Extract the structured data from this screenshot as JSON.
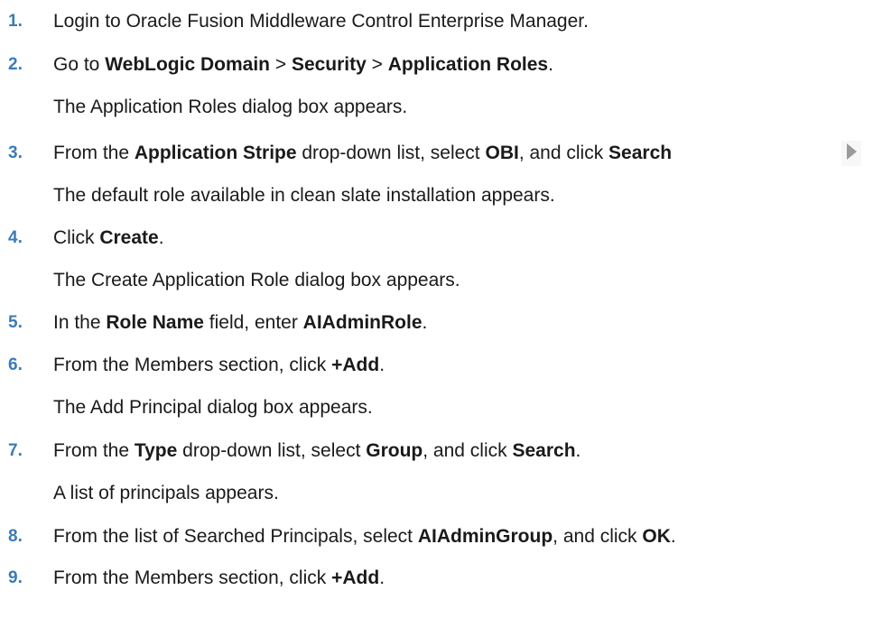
{
  "steps": [
    {
      "number": "1.",
      "parts": [
        {
          "t": "Login to Oracle Fusion Middleware Control Enterprise Manager.",
          "b": false
        }
      ],
      "result": ""
    },
    {
      "number": "2.",
      "parts": [
        {
          "t": "Go to ",
          "b": false
        },
        {
          "t": "WebLogic Domain",
          "b": true
        },
        {
          "t": " > ",
          "b": false
        },
        {
          "t": "Security",
          "b": true
        },
        {
          "t": " > ",
          "b": false
        },
        {
          "t": "Application Roles",
          "b": true
        },
        {
          "t": ".",
          "b": false
        }
      ],
      "result": "The Application Roles dialog box appears."
    },
    {
      "number": "3.",
      "parts": [
        {
          "t": "From the ",
          "b": false
        },
        {
          "t": "Application Stripe",
          "b": true
        },
        {
          "t": " drop-down list, select ",
          "b": false
        },
        {
          "t": "OBI",
          "b": true
        },
        {
          "t": ", and click ",
          "b": false
        },
        {
          "t": "Search",
          "b": true
        }
      ],
      "icon": "search-arrow-icon",
      "result": "The default role available in clean slate installation appears."
    },
    {
      "number": "4.",
      "parts": [
        {
          "t": "Click ",
          "b": false
        },
        {
          "t": "Create",
          "b": true
        },
        {
          "t": ".",
          "b": false
        }
      ],
      "result": "The Create Application Role dialog box appears."
    },
    {
      "number": "5.",
      "parts": [
        {
          "t": "In the ",
          "b": false
        },
        {
          "t": "Role Name",
          "b": true
        },
        {
          "t": " field, enter ",
          "b": false
        },
        {
          "t": "AIAdminRole",
          "b": true
        },
        {
          "t": ".",
          "b": false
        }
      ],
      "result": ""
    },
    {
      "number": "6.",
      "parts": [
        {
          "t": "From the Members section, click ",
          "b": false
        },
        {
          "t": "+Add",
          "b": true
        },
        {
          "t": ".",
          "b": false
        }
      ],
      "result": "The Add Principal dialog box appears."
    },
    {
      "number": "7.",
      "parts": [
        {
          "t": "From the ",
          "b": false
        },
        {
          "t": "Type",
          "b": true
        },
        {
          "t": " drop-down list, select ",
          "b": false
        },
        {
          "t": "Group",
          "b": true
        },
        {
          "t": ", and click ",
          "b": false
        },
        {
          "t": "Search",
          "b": true
        },
        {
          "t": ".",
          "b": false
        }
      ],
      "result": "A list of principals appears."
    },
    {
      "number": "8.",
      "parts": [
        {
          "t": "From the list of Searched Principals, select ",
          "b": false
        },
        {
          "t": "AIAdminGroup",
          "b": true
        },
        {
          "t": ", and click ",
          "b": false
        },
        {
          "t": "OK",
          "b": true
        },
        {
          "t": ".",
          "b": false
        }
      ],
      "result": ""
    },
    {
      "number": "9.",
      "parts": [
        {
          "t": "From the Members section, click ",
          "b": false
        },
        {
          "t": "+Add",
          "b": true
        },
        {
          "t": ".",
          "b": false
        }
      ],
      "result": ""
    }
  ],
  "colors": {
    "step_number": "#3a7bb8",
    "text": "#1a1a1a",
    "icon_fill": "#9a9a9a",
    "icon_bg": "#e8e8e8"
  }
}
